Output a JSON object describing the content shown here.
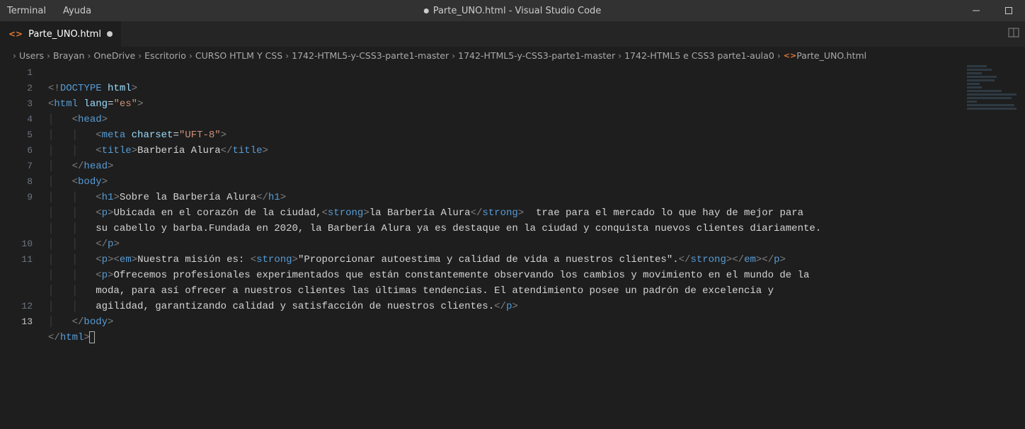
{
  "menu": {
    "items": [
      "Terminal",
      "Ayuda"
    ]
  },
  "window": {
    "title": "Parte_UNO.html - Visual Studio Code",
    "dirty": true
  },
  "tab": {
    "icon": "<>",
    "label": "Parte_UNO.html"
  },
  "breadcrumb": {
    "items": [
      "Users",
      "Brayan",
      "OneDrive",
      "Escritorio",
      "CURSO HTLM Y CSS",
      "1742-HTML5-y-CSS3-parte1-master",
      "1742-HTML5-y-CSS3-parte1-master",
      "1742-HTML5 e CSS3 parte1-aula0"
    ],
    "fileIcon": "<>",
    "file": "Parte_UNO.html"
  },
  "lines": [
    "1",
    "2",
    "3",
    "4",
    "5",
    "6",
    "7",
    "8",
    "9",
    "",
    "",
    "10",
    "11",
    "",
    "",
    "12",
    "13"
  ],
  "activeLine": "13",
  "code": {
    "l1a": "<!",
    "l1b": "DOCTYPE",
    "l1c": " html",
    "l1d": ">",
    "l2a": "<",
    "l2b": "html",
    "l2c": " lang",
    "l2d": "=",
    "l2e": "\"es\"",
    "l2f": ">",
    "l3a": "<",
    "l3b": "head",
    "l3c": ">",
    "l4a": "<",
    "l4b": "meta",
    "l4c": " charset",
    "l4d": "=",
    "l4e": "\"UFT-8\"",
    "l4f": ">",
    "l5a": "<",
    "l5b": "title",
    "l5c": ">",
    "l5d": "Barbería Alura",
    "l5e": "</",
    "l5f": "title",
    "l5g": ">",
    "l6a": "</",
    "l6b": "head",
    "l6c": ">",
    "l7a": "<",
    "l7b": "body",
    "l7c": ">",
    "l8a": "<",
    "l8b": "h1",
    "l8c": ">",
    "l8d": "Sobre la Barbería Alura",
    "l8e": "</",
    "l8f": "h1",
    "l8g": ">",
    "l9a": "<",
    "l9b": "p",
    "l9c": ">",
    "l9d": "Ubicada en el corazón de la ciudad,",
    "l9e": "<",
    "l9f": "strong",
    "l9g": ">",
    "l9h": "la Barbería Alura",
    "l9i": "</",
    "l9j": "strong",
    "l9k": ">",
    "l9l": "  trae para el mercado lo que hay de mejor para ",
    "l9m": "su cabello y barba.Fundada en 2020, la Barbería Alura ya es destaque en la ciudad y conquista nuevos clientes diariamente.",
    "l9n": "</",
    "l9o": "p",
    "l9p": ">",
    "l10a": "<",
    "l10b": "p",
    "l10c": "><",
    "l10d": "em",
    "l10e": ">",
    "l10f": "Nuestra misión es: ",
    "l10g": "<",
    "l10h": "strong",
    "l10i": ">",
    "l10j": "\"Proporcionar autoestima y calidad de vida a nuestros clientes\".",
    "l10k": "</",
    "l10l": "strong",
    "l10m": "></",
    "l10n": "em",
    "l10o": "></",
    "l10p": "p",
    "l10q": ">",
    "l11a": "<",
    "l11b": "p",
    "l11c": ">",
    "l11d": "Ofrecemos profesionales experimentados que están constantemente observando los cambios y movimiento en el mundo de la ",
    "l11e": "moda, para así ofrecer a nuestros clientes las últimas tendencias. El atendimiento posee un padrón de excelencia y ",
    "l11f": "agilidad, garantizando calidad y satisfacción de nuestros clientes.",
    "l11g": "</",
    "l11h": "p",
    "l11i": ">",
    "l12a": "</",
    "l12b": "body",
    "l12c": ">",
    "l13a": "</",
    "l13b": "html",
    "l13c": ">"
  }
}
